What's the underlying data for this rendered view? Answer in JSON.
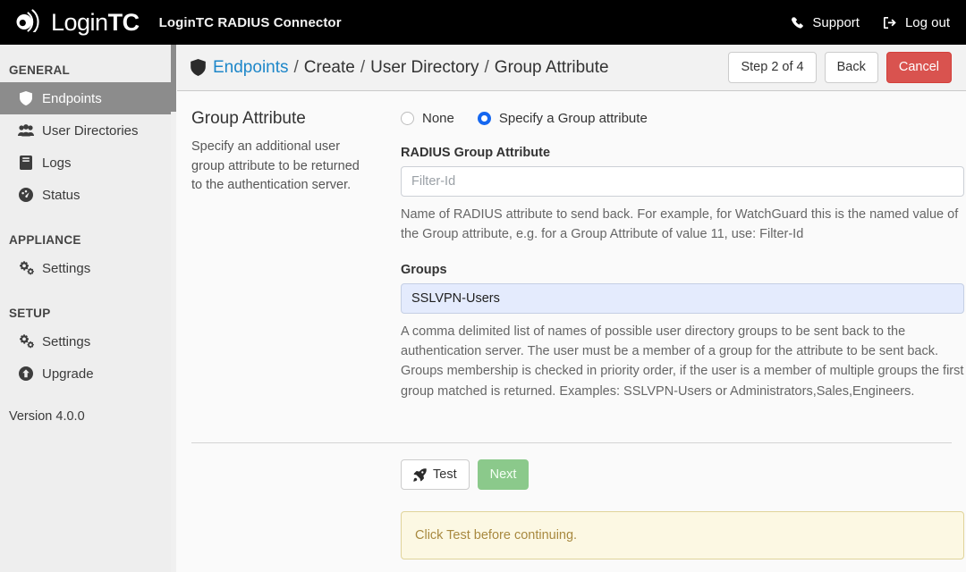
{
  "navbar": {
    "brand_login": "Login",
    "brand_tc": "TC",
    "app_title": "LoginTC RADIUS Connector",
    "support_label": "Support",
    "logout_label": "Log out",
    "support_icon": "phone-icon",
    "logout_icon": "sign-out-icon",
    "background": "#000000"
  },
  "sidebar": {
    "sections": [
      {
        "heading": "GENERAL"
      },
      {
        "heading": "APPLIANCE"
      },
      {
        "heading": "SETUP"
      }
    ],
    "general_items": [
      {
        "label": "Endpoints",
        "icon": "shield-icon",
        "active": true
      },
      {
        "label": "User Directories",
        "icon": "users-icon",
        "active": false
      },
      {
        "label": "Logs",
        "icon": "book-icon",
        "active": false
      },
      {
        "label": "Status",
        "icon": "dashboard-icon",
        "active": false
      }
    ],
    "appliance_items": [
      {
        "label": "Settings",
        "icon": "cogs-icon",
        "active": false
      }
    ],
    "setup_items": [
      {
        "label": "Settings",
        "icon": "cogs-icon",
        "active": false
      },
      {
        "label": "Upgrade",
        "icon": "arrow-circle-up-icon",
        "active": false
      }
    ],
    "version": "Version 4.0.0",
    "active_background": "#8c8c8c"
  },
  "header": {
    "breadcrumb_icon": "shield-icon",
    "breadcrumb_link": "Endpoints",
    "separator": "/",
    "breadcrumb_crumb_2": "Create",
    "breadcrumb_crumb_3": "User Directory",
    "breadcrumb_crumb_4": "Group Attribute",
    "link_color": "#1e87c9",
    "step_label": "Step 2 of 4",
    "back_label": "Back",
    "cancel_label": "Cancel",
    "cancel_color": "#d9534f"
  },
  "description": {
    "title": "Group Attribute",
    "body": "Specify an additional user group attribute to be returned to the authentication server."
  },
  "form": {
    "radio_options": [
      {
        "label": "None",
        "selected": false
      },
      {
        "label": "Specify a Group attribute",
        "selected": true
      }
    ],
    "radio_accent": "#1567f0",
    "radius_attribute": {
      "label": "RADIUS Group Attribute",
      "value": "",
      "placeholder": "Filter-Id",
      "help": "Name of RADIUS attribute to send back. For example, for WatchGuard this is the named value of the Group attribute, e.g. for a Group Attribute of value 11, use: Filter-Id"
    },
    "groups": {
      "label": "Groups",
      "value": "SSLVPN-Users",
      "placeholder": "",
      "autofill_background": "#e4ebfd",
      "help": "A comma delimited list of names of possible user directory groups to be sent back to the authentication server. The user must be a member of a group for the attribute to be sent back. Groups membership is checked in priority order, if the user is a member of multiple groups the first group matched is returned. Examples: SSLVPN-Users or Administrators,Sales,Engineers."
    },
    "test_label": "Test",
    "test_icon": "rocket-icon",
    "next_label": "Next",
    "next_color": "#8bc98b",
    "alert_message": "Click Test before continuing.",
    "alert_background": "#fcf8e3",
    "alert_text_color": "#a8893f"
  }
}
